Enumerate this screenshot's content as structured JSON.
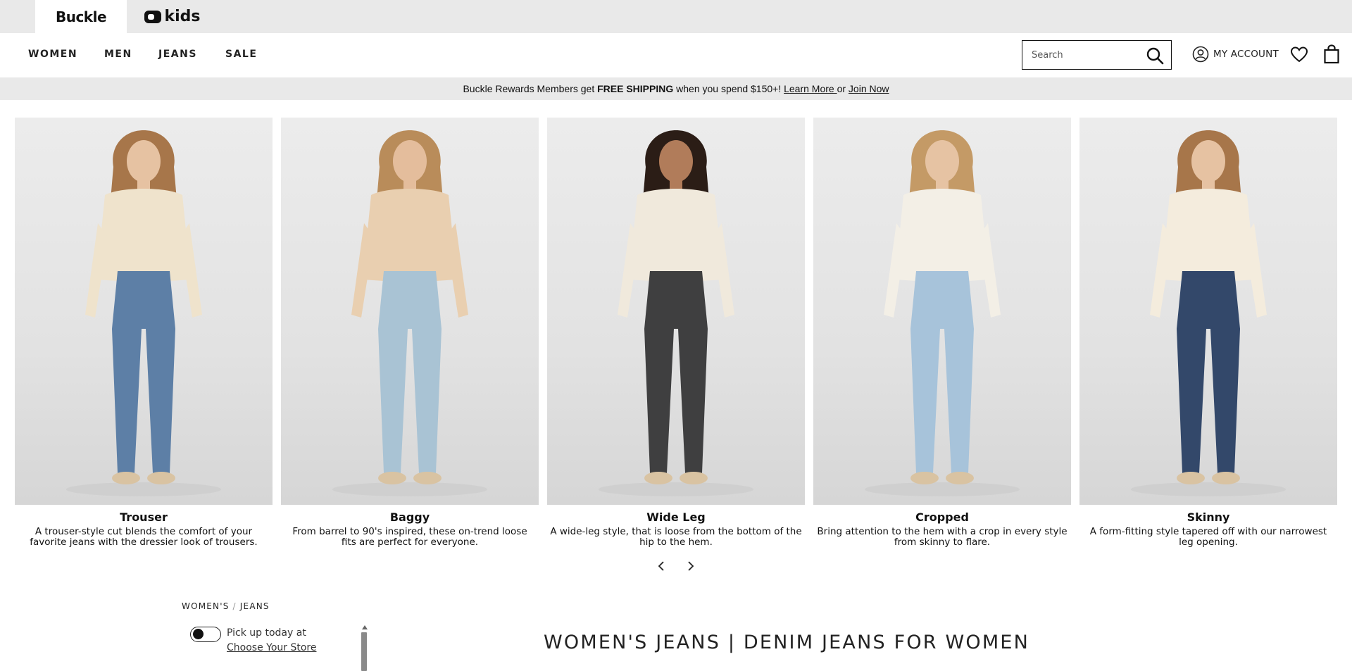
{
  "brand_tabs": [
    {
      "label": "Buckle"
    },
    {
      "label": "kids"
    }
  ],
  "nav": {
    "items": [
      {
        "label": "WOMEN"
      },
      {
        "label": "MEN"
      },
      {
        "label": "JEANS"
      },
      {
        "label": "SALE"
      }
    ],
    "search_placeholder": "Search",
    "account_label": "MY ACCOUNT"
  },
  "promo": {
    "text_before": "Buckle Rewards Members get ",
    "bold": "FREE SHIPPING",
    "text_after": " when you spend $150+! ",
    "learn_more": "Learn More ",
    "or": " or ",
    "join_now": "Join Now"
  },
  "categories": [
    {
      "title": "Trouser",
      "description": "A trouser-style cut blends the comfort of your favorite jeans with the dressier look of trousers.",
      "top_color": "#efe3cc",
      "denim_color": "#5d7fa6",
      "hair_color": "#a7764a",
      "skin_color": "#e6c2a2"
    },
    {
      "title": "Baggy",
      "description": "From barrel to 90's inspired, these on-trend loose fits are perfect for everyone.",
      "top_color": "#e9cfb0",
      "denim_color": "#a9c3d4",
      "hair_color": "#b98c5a",
      "skin_color": "#e4bd9c"
    },
    {
      "title": "Wide Leg",
      "description": "A wide-leg style, that is loose from the bottom of the hip to the hem.",
      "top_color": "#f0e9dc",
      "denim_color": "#3f3f40",
      "hair_color": "#2b1d16",
      "skin_color": "#b17c5a"
    },
    {
      "title": "Cropped",
      "description": "Bring attention to the hem with a crop in every style from skinny to flare.",
      "top_color": "#f3efe6",
      "denim_color": "#a7c3da",
      "hair_color": "#c49a66",
      "skin_color": "#e6c3a3"
    },
    {
      "title": "Skinny",
      "description": "A form-fitting style tapered off with our narrowest leg opening.",
      "top_color": "#f4ecdd",
      "denim_color": "#33486a",
      "hair_color": "#a7764a",
      "skin_color": "#e6c2a2"
    }
  ],
  "breadcrumb": [
    "WOMEN'S",
    "JEANS"
  ],
  "pickup": {
    "label": "Pick up today at",
    "link": "Choose Your Store"
  },
  "page_heading": "WOMEN'S JEANS | DENIM JEANS FOR WOMEN"
}
